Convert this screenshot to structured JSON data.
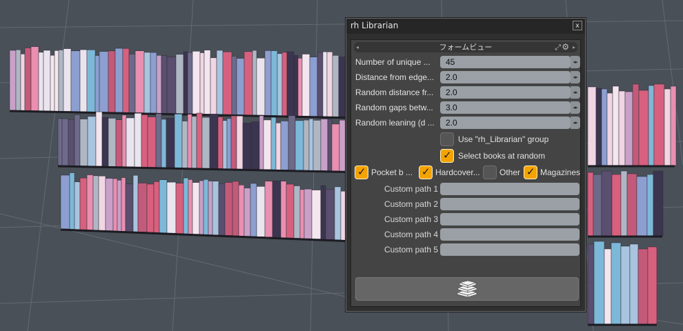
{
  "viewport": {
    "background": "#4a5058",
    "grid_color": "#6a7078"
  },
  "panel": {
    "title": "rh Librarian",
    "close_label": "x",
    "form_title": "フォームビュー",
    "fields": [
      {
        "label": "Number of unique  ...",
        "value": "45"
      },
      {
        "label": "Distance from edge...",
        "value": "2.0"
      },
      {
        "label": "Random distance fr...",
        "value": "2.0"
      },
      {
        "label": "Random gaps betw...",
        "value": "3.0"
      },
      {
        "label": "Random leaning (d  ...",
        "value": "2.0"
      }
    ],
    "use_group": {
      "label": "Use \"rh_Librarian\" group",
      "checked": false
    },
    "select_random": {
      "label": "Select books at random",
      "checked": true
    },
    "types": [
      {
        "label": "Pocket b  ...",
        "checked": true
      },
      {
        "label": "Hardcover...",
        "checked": true
      },
      {
        "label": "Other",
        "checked": false
      },
      {
        "label": "Magazines",
        "checked": true
      }
    ],
    "custom_paths": [
      {
        "label": "Custom path 1",
        "value": ""
      },
      {
        "label": "Custom path 2",
        "value": ""
      },
      {
        "label": "Custom path 3",
        "value": ""
      },
      {
        "label": "Custom path 4",
        "value": ""
      },
      {
        "label": "Custom path 5",
        "value": ""
      }
    ],
    "action_icon": "books-icon",
    "accent": "#f4a300"
  }
}
